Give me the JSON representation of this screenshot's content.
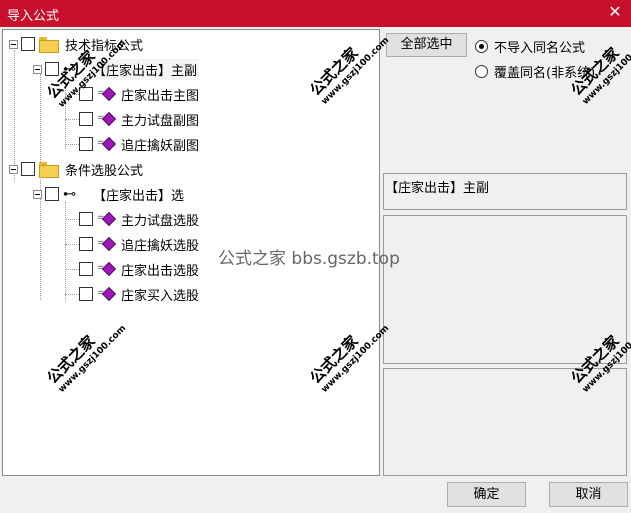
{
  "window": {
    "title": "导入公式",
    "close_glyph": "✕"
  },
  "tree": {
    "groups": [
      {
        "label": "技术指标公式",
        "subgroups": [
          {
            "label": "【庄家出击】主副",
            "items": [
              "庄家出击主图",
              "主力试盘副图",
              "追庄擒妖副图"
            ]
          }
        ]
      },
      {
        "label": "条件选股公式",
        "subgroups": [
          {
            "label": "【庄家出击】选",
            "items": [
              "主力试盘选股",
              "追庄擒妖选股",
              "庄家出击选股",
              "庄家买入选股"
            ]
          }
        ]
      }
    ]
  },
  "right_panel": {
    "select_all_label": "全部选中",
    "radio_options": [
      {
        "label": "不导入同名公式",
        "checked": true
      },
      {
        "label": "覆盖同名(非系统)",
        "checked": false
      }
    ],
    "selected_formula": "【庄家出击】主副"
  },
  "buttons": {
    "ok": "确定",
    "cancel": "取消"
  },
  "watermark": {
    "brand": "公式之家",
    "site": "www.gszj100.com",
    "center_text": "公式之家 bbs.gszb.top"
  },
  "colors": {
    "titlebar": "#c8102e",
    "folder": "#f5cf4f",
    "formula_gem": "#9b19b5"
  }
}
